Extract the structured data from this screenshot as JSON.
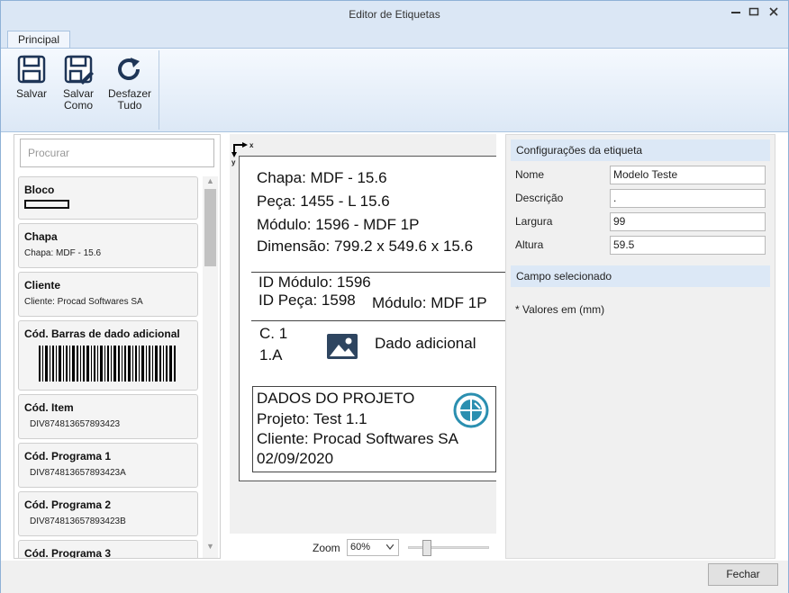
{
  "window": {
    "title": "Editor de Etiquetas"
  },
  "tabs": [
    {
      "label": "Principal"
    }
  ],
  "ribbon": {
    "save_label": "Salvar",
    "save_as_label_1": "Salvar",
    "save_as_label_2": "Como",
    "undo_label_1": "Desfazer",
    "undo_label_2": "Tudo"
  },
  "search": {
    "placeholder": "Procurar"
  },
  "components": [
    {
      "title": "Bloco",
      "sub": ""
    },
    {
      "title": "Chapa",
      "sub": "Chapa: MDF - 15.6"
    },
    {
      "title": "Cliente",
      "sub": "Cliente: Procad Softwares SA"
    },
    {
      "title": "Cód. Barras de dado adicional",
      "sub": ""
    },
    {
      "title": "Cód. Item",
      "sub": "DIV874813657893423"
    },
    {
      "title": "Cód. Programa 1",
      "sub": "DIV874813657893423A"
    },
    {
      "title": "Cód. Programa 2",
      "sub": "DIV874813657893423B"
    },
    {
      "title": "Cód. Programa 3",
      "sub": ""
    }
  ],
  "label_preview": {
    "axis_x": "x",
    "axis_y": "y",
    "line1": "Chapa: MDF - 15.6",
    "line2": "Peça: 1455 - L 15.6",
    "line3": "Módulo: 1596 - MDF 1P",
    "line4": "Dimensão: 799.2 x 549.6 x 15.6",
    "id_modulo": "ID Módulo: 1596",
    "id_peca": "ID Peça: 1598",
    "modulo": "Módulo: MDF 1P",
    "c1": "C. 1",
    "c2": "1.A",
    "dado": "Dado adicional",
    "proj_title": "DADOS DO PROJETO",
    "projeto": "Projeto: Test 1.1",
    "cliente": "Cliente: Procad Softwares SA",
    "data": "02/09/2020"
  },
  "zoom": {
    "label": "Zoom",
    "value": "60%"
  },
  "settings": {
    "header": "Configurações da etiqueta",
    "fields": [
      {
        "label": "Nome",
        "value": "Modelo Teste"
      },
      {
        "label": "Descrição",
        "value": "."
      },
      {
        "label": "Largura",
        "value": "99"
      },
      {
        "label": "Altura",
        "value": "59.5"
      }
    ],
    "selected_header": "Campo selecionado",
    "note": "* Valores em (mm)"
  },
  "footer": {
    "close_label": "Fechar"
  }
}
